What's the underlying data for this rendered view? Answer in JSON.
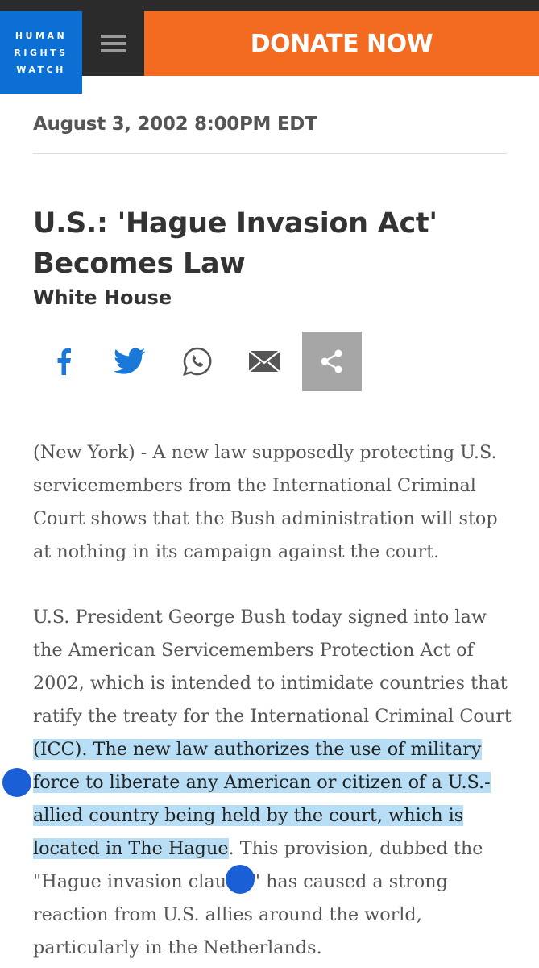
{
  "header": {
    "logo_lines": [
      "HUMAN",
      "RIGHTS",
      "WATCH"
    ],
    "donate_label": "DONATE NOW",
    "menu_icon": "hamburger-menu-icon"
  },
  "article": {
    "date": "August 3, 2002 8:00PM EDT",
    "title_line1": "U.S.: 'Hague Invasion Act'",
    "title_line2": "Becomes Law",
    "location": "White House",
    "share_icons": [
      "facebook-icon",
      "twitter-icon",
      "whatsapp-icon",
      "email-icon",
      "share-icon"
    ],
    "para1": "(New York) - A new law supposedly protecting U.S. servicemembers from the International Criminal Court shows that the Bush administration will stop at nothing in its campaign against the court.",
    "para2_before": "U.S. President George Bush today signed into law the American Servicemembers Protection Act of 2002, which is intended to intimidate countries that ratify the treaty for the International Criminal Court ",
    "para2_selected": "(ICC). The new law authorizes the use of military force to liberate any American or citizen of a U.S.-allied country being held by the court, which is located in The Hague",
    "para2_after": ". This provision, dubbed the \"Hague invasion clause,\" has caused a strong reaction from U.S. allies around the world, particularly in the Netherlands."
  },
  "colors": {
    "brand_blue": "#0b6fd3",
    "donate_orange": "#f26b21",
    "dark_bar": "#2b2b2b",
    "selection": "#b8def5",
    "selection_handle": "#1a5fd6",
    "social_blue": "#1a78d8"
  }
}
